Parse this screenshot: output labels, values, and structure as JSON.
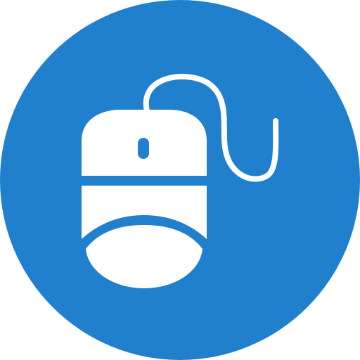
{
  "icon": {
    "name": "computer-mouse-icon",
    "background_shape": "circle",
    "colors": {
      "background": "#2180CE",
      "foreground": "#FFFFFF"
    }
  }
}
